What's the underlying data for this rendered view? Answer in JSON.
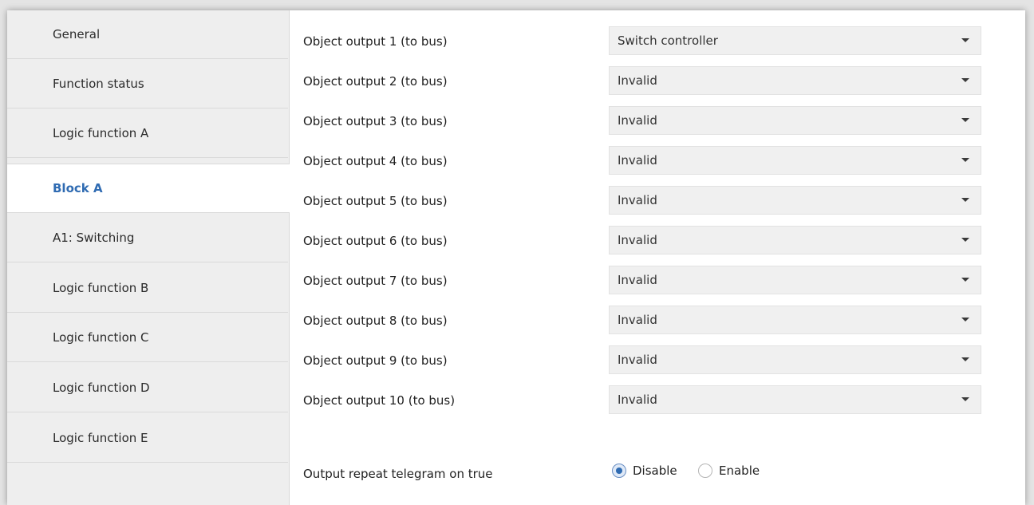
{
  "sidebar": {
    "items": [
      {
        "label": "General"
      },
      {
        "label": "Function status"
      },
      {
        "label": "Logic function A"
      },
      {
        "label": "Block A",
        "active": true
      },
      {
        "label": "A1: Switching"
      },
      {
        "label": "Logic function B"
      },
      {
        "label": "Logic function C"
      },
      {
        "label": "Logic function D"
      },
      {
        "label": "Logic function E"
      }
    ]
  },
  "params": [
    {
      "label": "Object output 1 (to bus)",
      "value": "Switch controller"
    },
    {
      "label": "Object output 2 (to bus)",
      "value": "Invalid"
    },
    {
      "label": "Object output 3 (to bus)",
      "value": "Invalid"
    },
    {
      "label": "Object output 4 (to bus)",
      "value": "Invalid"
    },
    {
      "label": "Object output 5 (to bus)",
      "value": "Invalid"
    },
    {
      "label": "Object output 6 (to bus)",
      "value": "Invalid"
    },
    {
      "label": "Object output 7 (to bus)",
      "value": "Invalid"
    },
    {
      "label": "Object output 8 (to bus)",
      "value": "Invalid"
    },
    {
      "label": "Object output 9 (to bus)",
      "value": "Invalid"
    },
    {
      "label": "Object output 10 (to bus)",
      "value": "Invalid"
    }
  ],
  "repeat": {
    "label": "Output repeat telegram on true",
    "options": [
      {
        "label": "Disable",
        "selected": true
      },
      {
        "label": "Enable",
        "selected": false
      }
    ]
  },
  "colors": {
    "accent": "#2f6bb2",
    "sidebar_bg": "#eeeeee",
    "select_bg": "#f0f0f0"
  },
  "icons": {
    "dropdown": "chevron-down-icon"
  }
}
